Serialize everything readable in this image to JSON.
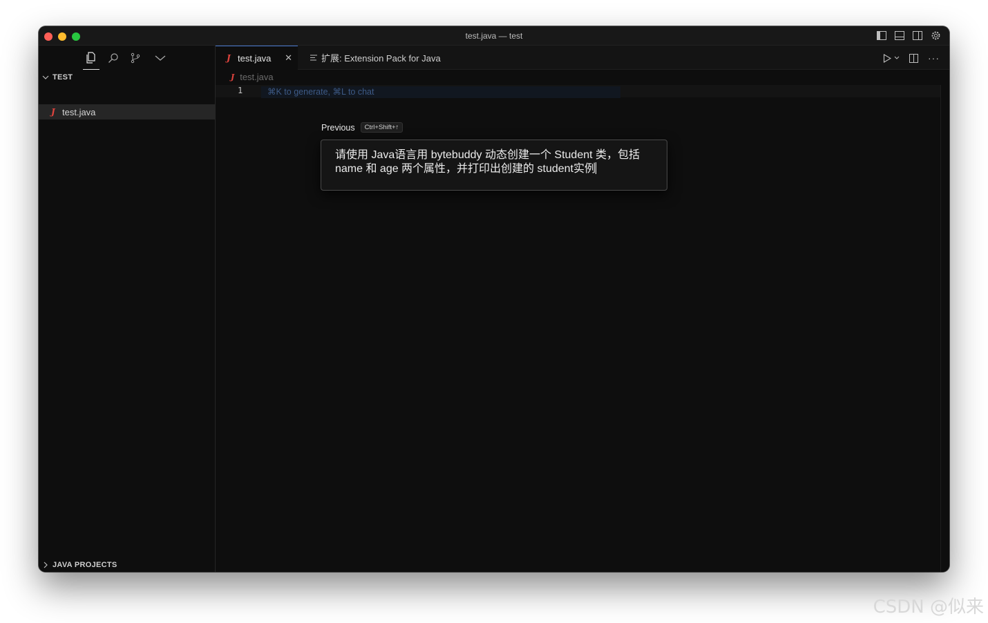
{
  "window": {
    "title": "test.java — test"
  },
  "sidebar": {
    "icons": [
      "files-icon",
      "search-icon",
      "source-control-icon",
      "chevron-down-icon"
    ],
    "explorer_section": "TEST",
    "file_item": "test.java",
    "bottom_section": "JAVA PROJECTS"
  },
  "tabs": [
    {
      "label": "test.java",
      "active": true
    },
    {
      "label": "扩展: Extension Pack for Java",
      "active": false
    }
  ],
  "editor": {
    "breadcrumb": "test.java",
    "line_number": "1",
    "hint": "⌘K to generate, ⌘L to chat",
    "previous_label": "Previous",
    "previous_shortcut": "Ctrl+Shift+↑",
    "prompt_text": "请使用 Java语言用 bytebuddy 动态创建一个 Student 类，包括 name 和 age 两个属性，并打印出创建的 student实例"
  },
  "watermark": "CSDN @似来",
  "colors": {
    "java_icon": "#e0443e",
    "accent": "#4a7bd1",
    "background": "#0e0e0e"
  }
}
